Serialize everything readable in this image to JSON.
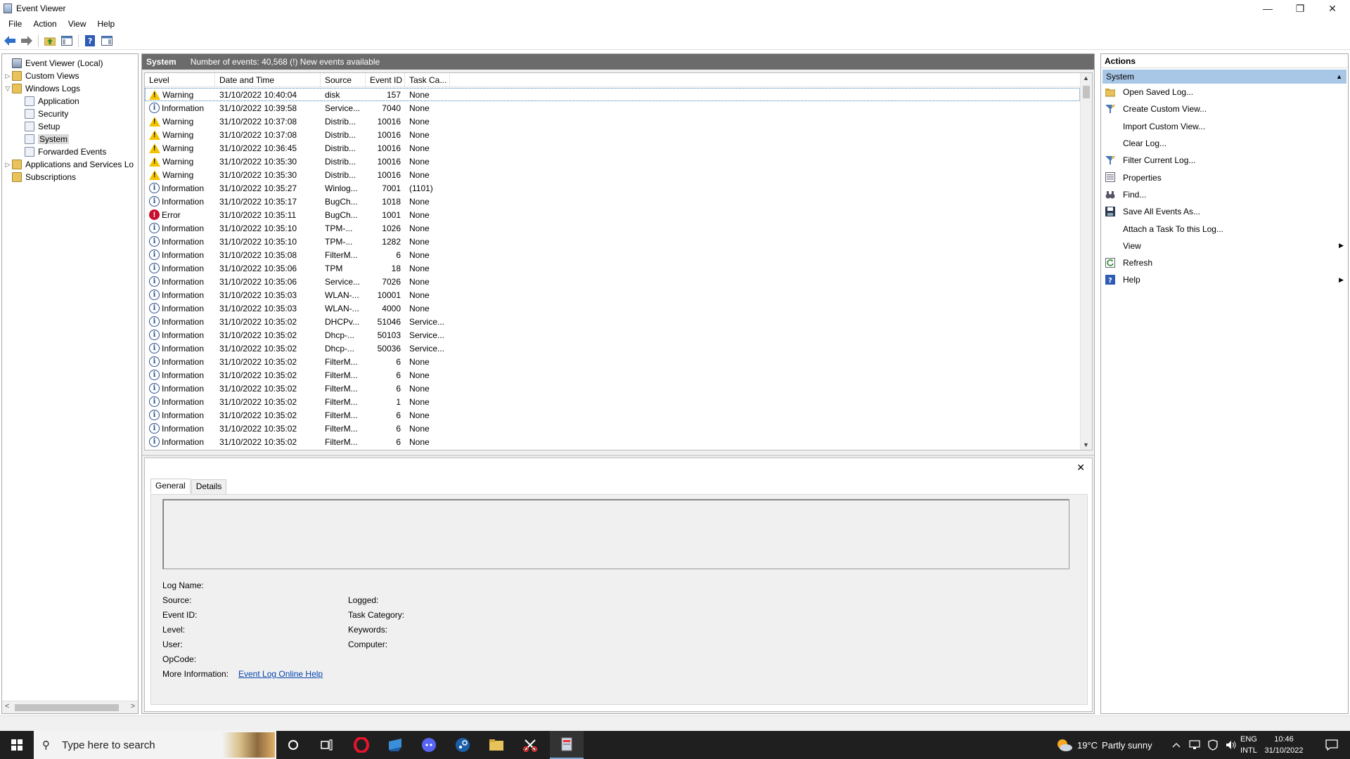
{
  "window": {
    "title": "Event Viewer",
    "minimize": "—",
    "restore": "❐",
    "close": "✕"
  },
  "menu": [
    "File",
    "Action",
    "View",
    "Help"
  ],
  "tree": {
    "items": [
      {
        "label": "Event Viewer (Local)",
        "level": 0,
        "expander": "",
        "icon": "event-viewer-icon"
      },
      {
        "label": "Custom Views",
        "level": 0,
        "expander": ">",
        "icon": "folder-icon"
      },
      {
        "label": "Windows Logs",
        "level": 0,
        "expander": "v",
        "icon": "folder-icon"
      },
      {
        "label": "Application",
        "level": 1,
        "expander": "",
        "icon": "log-icon"
      },
      {
        "label": "Security",
        "level": 1,
        "expander": "",
        "icon": "log-icon"
      },
      {
        "label": "Setup",
        "level": 1,
        "expander": "",
        "icon": "log-icon"
      },
      {
        "label": "System",
        "level": 1,
        "expander": "",
        "icon": "log-icon",
        "selected": true
      },
      {
        "label": "Forwarded Events",
        "level": 1,
        "expander": "",
        "icon": "log-icon"
      },
      {
        "label": "Applications and Services Lo",
        "level": 0,
        "expander": ">",
        "icon": "folder-icon"
      },
      {
        "label": "Subscriptions",
        "level": 0,
        "expander": "",
        "icon": "folder-icon"
      }
    ]
  },
  "log_header": {
    "name": "System",
    "summary": "Number of events: 40,568 (!) New events available"
  },
  "columns": [
    "Level",
    "Date and Time",
    "Source",
    "Event ID",
    "Task Ca..."
  ],
  "events": [
    [
      "Warning",
      "31/10/2022 10:40:04",
      "disk",
      "157",
      "None"
    ],
    [
      "Information",
      "31/10/2022 10:39:58",
      "Service...",
      "7040",
      "None"
    ],
    [
      "Warning",
      "31/10/2022 10:37:08",
      "Distrib...",
      "10016",
      "None"
    ],
    [
      "Warning",
      "31/10/2022 10:37:08",
      "Distrib...",
      "10016",
      "None"
    ],
    [
      "Warning",
      "31/10/2022 10:36:45",
      "Distrib...",
      "10016",
      "None"
    ],
    [
      "Warning",
      "31/10/2022 10:35:30",
      "Distrib...",
      "10016",
      "None"
    ],
    [
      "Warning",
      "31/10/2022 10:35:30",
      "Distrib...",
      "10016",
      "None"
    ],
    [
      "Information",
      "31/10/2022 10:35:27",
      "Winlog...",
      "7001",
      "(1101)"
    ],
    [
      "Information",
      "31/10/2022 10:35:17",
      "BugCh...",
      "1018",
      "None"
    ],
    [
      "Error",
      "31/10/2022 10:35:11",
      "BugCh...",
      "1001",
      "None"
    ],
    [
      "Information",
      "31/10/2022 10:35:10",
      "TPM-...",
      "1026",
      "None"
    ],
    [
      "Information",
      "31/10/2022 10:35:10",
      "TPM-...",
      "1282",
      "None"
    ],
    [
      "Information",
      "31/10/2022 10:35:08",
      "FilterM...",
      "6",
      "None"
    ],
    [
      "Information",
      "31/10/2022 10:35:06",
      "TPM",
      "18",
      "None"
    ],
    [
      "Information",
      "31/10/2022 10:35:06",
      "Service...",
      "7026",
      "None"
    ],
    [
      "Information",
      "31/10/2022 10:35:03",
      "WLAN-...",
      "10001",
      "None"
    ],
    [
      "Information",
      "31/10/2022 10:35:03",
      "WLAN-...",
      "4000",
      "None"
    ],
    [
      "Information",
      "31/10/2022 10:35:02",
      "DHCPv...",
      "51046",
      "Service..."
    ],
    [
      "Information",
      "31/10/2022 10:35:02",
      "Dhcp-...",
      "50103",
      "Service..."
    ],
    [
      "Information",
      "31/10/2022 10:35:02",
      "Dhcp-...",
      "50036",
      "Service..."
    ],
    [
      "Information",
      "31/10/2022 10:35:02",
      "FilterM...",
      "6",
      "None"
    ],
    [
      "Information",
      "31/10/2022 10:35:02",
      "FilterM...",
      "6",
      "None"
    ],
    [
      "Information",
      "31/10/2022 10:35:02",
      "FilterM...",
      "6",
      "None"
    ],
    [
      "Information",
      "31/10/2022 10:35:02",
      "FilterM...",
      "1",
      "None"
    ],
    [
      "Information",
      "31/10/2022 10:35:02",
      "FilterM...",
      "6",
      "None"
    ],
    [
      "Information",
      "31/10/2022 10:35:02",
      "FilterM...",
      "6",
      "None"
    ],
    [
      "Information",
      "31/10/2022 10:35:02",
      "FilterM...",
      "6",
      "None"
    ]
  ],
  "detail": {
    "close": "✕",
    "tabs": [
      "General",
      "Details"
    ],
    "left_fields": [
      "Log Name:",
      "Source:",
      "Event ID:",
      "Level:",
      "User:",
      "OpCode:",
      "More Information:"
    ],
    "right_fields": [
      "Logged:",
      "Task Category:",
      "Keywords:",
      "Computer:"
    ],
    "help_link": "Event Log Online Help"
  },
  "actions": {
    "title": "Actions",
    "group": "System",
    "items": [
      {
        "label": "Open Saved Log...",
        "icon": "open-folder-icon"
      },
      {
        "label": "Create Custom View...",
        "icon": "filter-icon"
      },
      {
        "label": "Import Custom View...",
        "icon": ""
      },
      {
        "label": "Clear Log...",
        "icon": ""
      },
      {
        "label": "Filter Current Log...",
        "icon": "filter-icon"
      },
      {
        "label": "Properties",
        "icon": "properties-icon"
      },
      {
        "label": "Find...",
        "icon": "binoculars-icon"
      },
      {
        "label": "Save All Events As...",
        "icon": "save-icon"
      },
      {
        "label": "Attach a Task To this Log...",
        "icon": ""
      },
      {
        "label": "View",
        "icon": "",
        "submenu": true
      },
      {
        "label": "Refresh",
        "icon": "refresh-icon"
      },
      {
        "label": "Help",
        "icon": "help-icon",
        "submenu": true
      }
    ]
  },
  "taskbar": {
    "search_placeholder": "Type here to search",
    "weather_temp": "19°C",
    "weather_text": "Partly sunny",
    "lang_top": "ENG",
    "lang_bottom": "INTL",
    "time": "10:46",
    "date": "31/10/2022"
  },
  "colors": {
    "header_bg": "#6b6b6b",
    "actions_group_bg": "#a8c6e6",
    "taskbar_bg": "#1f1f1f",
    "link": "#0645ad"
  }
}
